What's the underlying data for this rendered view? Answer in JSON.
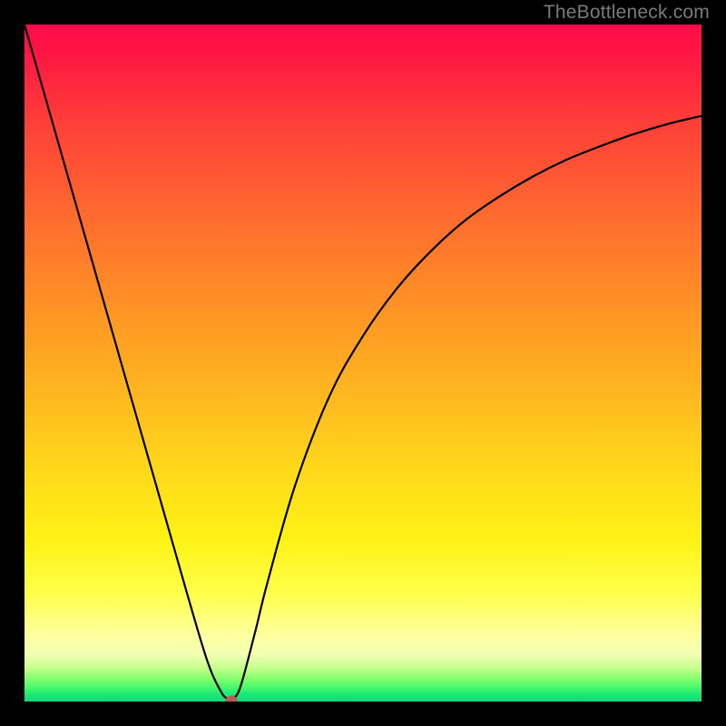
{
  "watermark": "TheBottleneck.com",
  "chart_data": {
    "type": "line",
    "title": "",
    "xlabel": "",
    "ylabel": "",
    "xlim": [
      0,
      100
    ],
    "ylim": [
      0,
      100
    ],
    "grid": false,
    "legend": false,
    "series": [
      {
        "name": "curve",
        "x": [
          0,
          4,
          8,
          12,
          16,
          20,
          24,
          27,
          29,
          30,
          30.5,
          31,
          32,
          34,
          36,
          40,
          45,
          50,
          55,
          60,
          65,
          70,
          75,
          80,
          85,
          90,
          95,
          100
        ],
        "y": [
          100,
          86,
          72,
          58,
          44,
          30,
          16,
          6,
          1.5,
          0.4,
          0.2,
          0.5,
          2.5,
          10,
          18,
          32,
          45,
          54,
          61,
          66.5,
          71,
          74.5,
          77.5,
          80,
          82,
          83.8,
          85.3,
          86.5
        ]
      }
    ],
    "marker": {
      "x": 30.5,
      "y": 0.2
    },
    "background_gradient": {
      "stops": [
        {
          "pos": 0,
          "color": "#ff0a4a"
        },
        {
          "pos": 14,
          "color": "#ff3d39"
        },
        {
          "pos": 42,
          "color": "#ff9325"
        },
        {
          "pos": 66,
          "color": "#ffd91a"
        },
        {
          "pos": 84,
          "color": "#ffff4a"
        },
        {
          "pos": 95,
          "color": "#c6ff8e"
        },
        {
          "pos": 100,
          "color": "#14d778"
        }
      ]
    }
  }
}
